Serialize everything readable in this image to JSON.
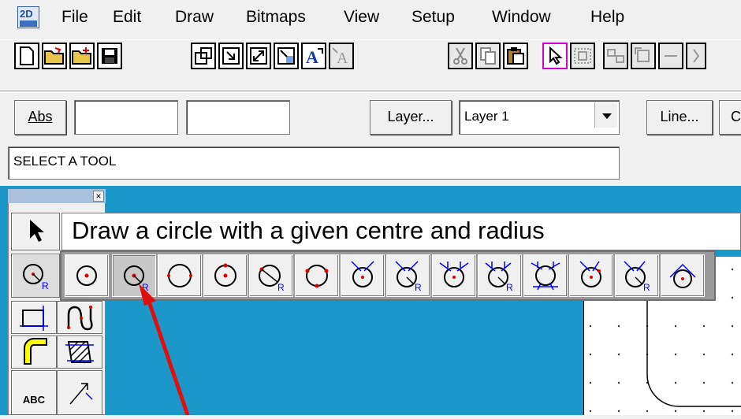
{
  "app": {
    "icon_top": "2D",
    "icon_name": "2d-design-app-icon"
  },
  "menu": [
    "File",
    "Edit",
    "Draw",
    "Bitmaps",
    "View",
    "Setup",
    "Window",
    "Help"
  ],
  "toolbar_icons": [
    "new-file-icon",
    "open-folder-icon",
    "open-add-folder-icon",
    "save-icon",
    "zoom-window-icon",
    "zoom-previous-icon",
    "zoom-extents-icon",
    "zoom-fill-icon",
    "text-add-icon",
    "text-edit-icon",
    "cut-icon",
    "copy-icon",
    "paste-icon",
    "select-pointer-icon",
    "group-icon",
    "ungroup-icon",
    "rotate-icon"
  ],
  "row2": {
    "abs_button": "Abs",
    "coord_x": "",
    "coord_y": "",
    "layer_button": "Layer...",
    "layer_select": "Layer 1",
    "line_button": "Line...",
    "cut_off_button": "C"
  },
  "status": "SELECT A TOOL",
  "palette": {
    "close_glyph": "×",
    "tools": [
      "pointer-tool-icon",
      "circle-radius-tool-icon",
      "rectangle-tool-icon",
      "spline-tool-icon",
      "fillet-tool-icon",
      "hatch-tool-icon",
      "text-tool-icon",
      "dimension-tool-icon"
    ],
    "bottom_label": "ABC"
  },
  "tooltip": "Draw a circle with a given centre and radius",
  "flyout": [
    "circle-centre-point-icon",
    "circle-centre-radius-icon",
    "circle-two-points-icon",
    "circle-centre-point-dot-icon",
    "circle-radius-r-icon",
    "circle-three-points-icon",
    "circle-tangent-icon",
    "circle-tangent-radius-icon",
    "circle-two-tangents-icon",
    "circle-two-tangents-radius-icon",
    "circle-three-tangents-icon",
    "circle-tangent-point-icon",
    "circle-tangent-point-radius-icon",
    "circle-tangent-line-icon"
  ],
  "colors": {
    "canvas": "#1c97c9",
    "accent": "#0000ff",
    "arrow": "#e01010"
  }
}
